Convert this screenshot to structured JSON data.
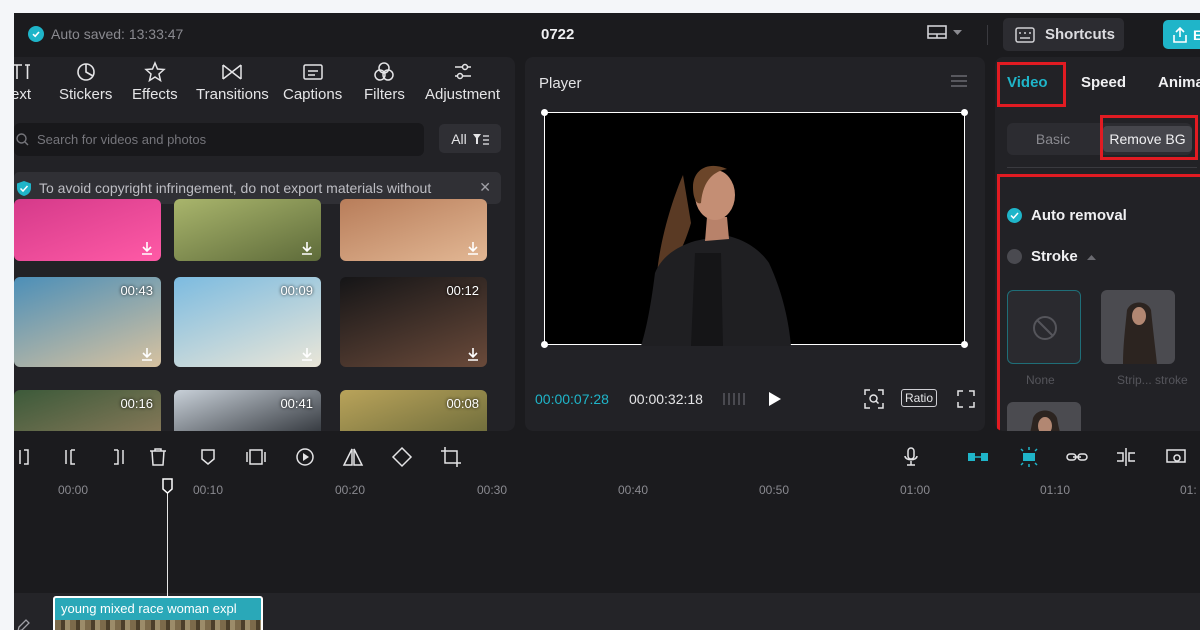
{
  "topbar": {
    "saved_text": "Auto saved: 13:33:47",
    "project_title": "0722",
    "shortcuts_label": "Shortcuts",
    "export_label": "E"
  },
  "media": {
    "tabs": [
      {
        "label": "ext",
        "icon": "text-icon"
      },
      {
        "label": "Stickers",
        "icon": "sticker-icon"
      },
      {
        "label": "Effects",
        "icon": "effects-icon"
      },
      {
        "label": "Transitions",
        "icon": "transitions-icon"
      },
      {
        "label": "Captions",
        "icon": "captions-icon"
      },
      {
        "label": "Filters",
        "icon": "filters-icon"
      },
      {
        "label": "Adjustment",
        "icon": "adjustment-icon"
      }
    ],
    "search_placeholder": "Search for videos and photos",
    "filter_label": "All",
    "notice_text": "To avoid copyright infringement, do not export materials without",
    "thumbs": [
      {
        "duration": "",
        "colors": [
          "#d53a8a",
          "#ff5aa6"
        ]
      },
      {
        "duration": "",
        "colors": [
          "#a9b56c",
          "#5e6b3a"
        ]
      },
      {
        "duration": "",
        "colors": [
          "#b87d5a",
          "#e2b794"
        ]
      },
      {
        "duration": "00:43",
        "colors": [
          "#4c8fb8",
          "#d7c2a0"
        ]
      },
      {
        "duration": "00:09",
        "colors": [
          "#7cbbe0",
          "#eae6d8"
        ]
      },
      {
        "duration": "00:12",
        "colors": [
          "#151517",
          "#6a4a3a"
        ]
      },
      {
        "duration": "00:16",
        "colors": [
          "#3c5a3a",
          "#8a7a5a"
        ]
      },
      {
        "duration": "00:41",
        "colors": [
          "#c8d0d8",
          "#2a2e34"
        ]
      },
      {
        "duration": "00:08",
        "colors": [
          "#b9a35a",
          "#6b6a3a"
        ]
      }
    ]
  },
  "player": {
    "title": "Player",
    "current_time": "00:00:07:28",
    "total_time": "00:00:32:18",
    "ratio_label": "Ratio"
  },
  "inspector": {
    "tabs": [
      "Video",
      "Speed",
      "Anima"
    ],
    "segment": {
      "basic": "Basic",
      "remove_bg": "Remove BG"
    },
    "auto_removal_label": "Auto removal",
    "stroke_label": "Stroke",
    "tiles": [
      {
        "label": "None"
      },
      {
        "label": "Strip... stroke"
      }
    ],
    "accent_color": "#1fb5c9",
    "highlight_color": "#e11b22"
  },
  "timeline": {
    "ticks": [
      "00:00",
      "00:10",
      "00:20",
      "00:30",
      "00:40",
      "00:50",
      "01:00",
      "01:10",
      "01:"
    ],
    "clip_label": "young mixed race woman expl"
  }
}
